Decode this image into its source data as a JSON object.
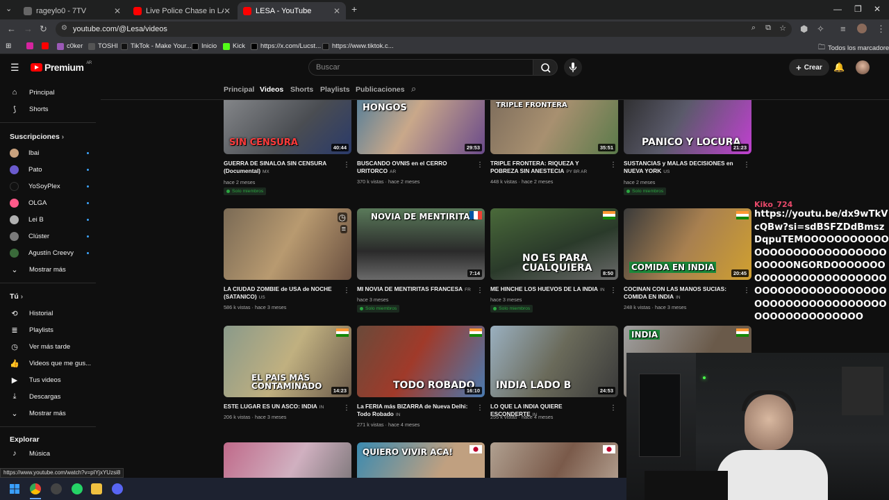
{
  "browser": {
    "tabs": [
      {
        "title": "rageylo0 - 7TV",
        "active": false
      },
      {
        "title": "Live Police Chase in LA - YouTu",
        "active": false
      },
      {
        "title": "LESA - YouTube",
        "active": true
      }
    ],
    "url": "youtube.com/@Lesa/videos",
    "bookmarks": [
      "c0ker",
      "TOSHI",
      "TikTok - Make Your...",
      "Inicio",
      "Kick",
      "https://x.com/Lucst...",
      "https://www.tiktok.c..."
    ],
    "bookmarks_folder": "Todos los marcadores"
  },
  "youtube": {
    "logo": "Premium",
    "logo_region": "AR",
    "search_placeholder": "Buscar",
    "create_label": "Crear"
  },
  "sidebar": {
    "main": [
      {
        "label": "Principal",
        "icon": "home-icon"
      },
      {
        "label": "Shorts",
        "icon": "shorts-icon"
      }
    ],
    "subs_title": "Suscripciones",
    "subs": [
      {
        "label": "Ibai",
        "color": "#c9a27e"
      },
      {
        "label": "Pato",
        "color": "#6a5acd"
      },
      {
        "label": "YoSoyPlex",
        "color": "#111111"
      },
      {
        "label": "OLGA",
        "color": "#ff5a8a"
      },
      {
        "label": "Lei B",
        "color": "#b0b0b0"
      },
      {
        "label": "Clúster",
        "color": "#7a7a7a"
      },
      {
        "label": "Agustín Creevy",
        "color": "#3a6a3a"
      }
    ],
    "subs_more": "Mostrar más",
    "you_title": "Tú",
    "you": [
      {
        "label": "Historial",
        "icon": "history-icon"
      },
      {
        "label": "Playlists",
        "icon": "playlists-icon"
      },
      {
        "label": "Ver más tarde",
        "icon": "watch-later-icon"
      },
      {
        "label": "Videos que me gus...",
        "icon": "like-icon"
      },
      {
        "label": "Tus videos",
        "icon": "your-videos-icon"
      },
      {
        "label": "Descargas",
        "icon": "download-icon"
      },
      {
        "label": "Mostrar más",
        "icon": "chevron-down-icon"
      }
    ],
    "explore_title": "Explorar",
    "explore": [
      {
        "label": "Música",
        "icon": "music-icon"
      }
    ]
  },
  "channel_tabs": [
    "Principal",
    "Videos",
    "Shorts",
    "Playlists",
    "Publicaciones"
  ],
  "videos": [
    {
      "title": "GUERRA DE SINALOA SIN CENSURA (Documental)",
      "cc": "MX",
      "views": "",
      "age": "hace 2 meses",
      "duration": "40:44",
      "members": true,
      "overlay": "SIN CENSURA"
    },
    {
      "title": "BUSCANDO OVNIS en el CERRO URITORCO",
      "cc": "AR",
      "views": "370 k vistas",
      "age": "hace 2 meses",
      "duration": "29:53",
      "members": false,
      "overlay": "HONGOS"
    },
    {
      "title": "TRIPLE FRONTERA: RIQUEZA Y POBREZA SIN ANESTECIA",
      "cc": "PY BR AR",
      "views": "448 k vistas",
      "age": "hace 2 meses",
      "duration": "35:51",
      "members": false,
      "overlay": "TRIPLE FRONTERA"
    },
    {
      "title": "SUSTANCIAS y MALAS DECISIONES en NUEVA YORK",
      "cc": "US",
      "views": "",
      "age": "hace 2 meses",
      "duration": "21:23",
      "members": true,
      "overlay": "PANICO Y LOCURA"
    },
    {
      "title": "LA CIUDAD ZOMBIE de USA de NOCHE (SATANICO)",
      "cc": "US",
      "views": "586 k vistas",
      "age": "hace 3 meses",
      "duration": "",
      "members": false,
      "overlay": ""
    },
    {
      "title": "MI NOVIA DE MENTIRITAS FRANCESA",
      "cc": "FR",
      "views": "",
      "age": "hace 3 meses",
      "duration": "7:14",
      "members": true,
      "overlay": "NOVIA DE MENTIRITAS"
    },
    {
      "title": "ME HINCHE LOS HUEVOS DE LA INDIA",
      "cc": "IN",
      "views": "",
      "age": "hace 3 meses",
      "duration": "8:50",
      "members": true,
      "overlay": "NO ES PARA CUALQUIERA"
    },
    {
      "title": "COCINAN CON LAS MANOS SUCIAS: COMIDA EN INDIA",
      "cc": "IN",
      "views": "248 k vistas",
      "age": "hace 3 meses",
      "duration": "20:45",
      "members": false,
      "overlay": "COMIDA EN INDIA"
    },
    {
      "title": "ESTE LUGAR ES UN ASCO: INDIA",
      "cc": "IN",
      "views": "206 k vistas",
      "age": "hace 3 meses",
      "duration": "14:23",
      "members": false,
      "overlay": "EL PAIS MÁS CONTAMINADO"
    },
    {
      "title": "La FERIA más BIZARRA de Nueva Delhi: Todo Robado",
      "cc": "IN",
      "views": "271 k vistas",
      "age": "hace 4 meses",
      "duration": "16:10",
      "members": false,
      "overlay": "TODO ROBADO"
    },
    {
      "title": "LO QUE LA INDIA QUIERE ESCONDERTE",
      "cc": "IN",
      "views": "255 k vistas",
      "age": "hace 4 meses",
      "duration": "24:53",
      "members": false,
      "overlay": "INDIA LADO B"
    },
    {
      "title": "",
      "cc": "",
      "views": "",
      "age": "",
      "duration": "",
      "members": false,
      "overlay": "INDIA"
    },
    {
      "title": "",
      "cc": "",
      "views": "",
      "age": "",
      "duration": "",
      "members": false,
      "overlay": ""
    },
    {
      "title": "",
      "cc": "",
      "views": "",
      "age": "",
      "duration": "",
      "members": false,
      "overlay": "QUIERO VIVIR ACA!"
    },
    {
      "title": "",
      "cc": "",
      "views": "",
      "age": "",
      "duration": "",
      "members": false,
      "overlay": ""
    }
  ],
  "members_label": "Solo miembros",
  "chat": {
    "username": "Kiko_724",
    "message": "https://youtu.be/dx9wTkVcQBw?si=sdBSFZDdBmszDqpuTEMOOOOOOOOOOOOOOOOOOOOOOOOOOOOOOOOONGORDOOOOOOOOOOOOOOOOOOOOOOOOOOOOOOOOOOOOOOOOOOOOOOOOOOOOOOOOOOOOOOOOOOOOOOOO"
  },
  "status_url": "https://www.youtube.com/watch?v=pIYjxYUzsi8",
  "colors": {
    "accent": "#ff0000",
    "members": "#2ba640",
    "chat_user": "#e9496a"
  }
}
